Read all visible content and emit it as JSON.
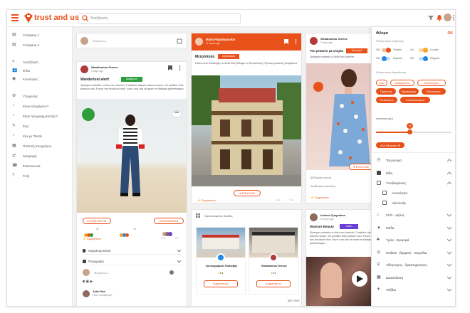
{
  "app": {
    "brand": "trust and use"
  },
  "search": {
    "placeholder": "Αναζήτηση"
  },
  "sidebar": {
    "items": [
      {
        "label": "Company 1",
        "icon": "company-icon"
      },
      {
        "label": "Company 2",
        "icon": "company-icon"
      },
      {
        "label": "Αναζήτηση",
        "icon": "pin-icon"
      },
      {
        "label": "Φίλοι",
        "icon": "friends-icon"
      },
      {
        "label": "Κοινότητες",
        "icon": "community-icon"
      },
      {
        "label": "Υπηρεσίες",
        "icon": "settings-icon"
      },
      {
        "label": "Είναι ελεγχόμενο?",
        "icon": "person-icon"
      },
      {
        "label": "Είναι προγραμματιστής?",
        "icon": "person-icon"
      },
      {
        "label": "Εύρ",
        "icon": "edit-icon"
      },
      {
        "label": "Καν με Tendo",
        "icon": "person-icon"
      },
      {
        "label": "Πολιτική απορρήτου",
        "icon": "policy-icon"
      },
      {
        "label": "Διαγραφή",
        "icon": "delete-icon"
      },
      {
        "label": "Επικοινωνία",
        "icon": "contact-icon"
      },
      {
        "label": "FAQ",
        "icon": "help-icon"
      }
    ]
  },
  "col1": {
    "compose_placeholder": "Μοιράσου...",
    "post": {
      "author": "Stradivarius Greece",
      "time": "5 days ago",
      "title": "Wanderlust alert!",
      "badge": "Διαφήμιση",
      "body": "Quisque molestie a dolor nec laoreet. Curabitur aliquet mauris neque, vel porttitor felis pretium sed. Fusce nec tincidunt nibh. Nunc non-nisi sit amet mi tristique pellentesque.",
      "like_label": "ΕΠΙΚΥΝΩ",
      "like_count": "95",
      "contact_label": "ΕΠΙΚΟΙΝΩΝΙΑ",
      "reactions_count": "32",
      "reactions_count2": "14",
      "comments_link": "Εμφανίσεις",
      "comment_count": "3",
      "share_count": "5",
      "dropdowns": [
        "Χαρακτηριστικά",
        "Περιγραφή"
      ],
      "comment_placeholder": "Μοιράσου...",
      "commenter_name": "John Doe",
      "commenter_text": "Πολύ ενδιαφέρον!"
    }
  },
  "col2": {
    "post": {
      "author": "Maria Papadopoulou",
      "time": "11 hours ago",
      "title": "Μετρόπολη",
      "badge": "Σχεδιασμός",
      "body": "Πόσο είναι Κασσιοβή το αλλά 8ev βάλαμε το Μετρόπολη ?Χρυσό γεώλιτα ξυλοβολευτ",
      "like_label": "ΕΠΙΚΥΝΩ",
      "comments_link": "Εμφανίσεις",
      "comment_count": "1",
      "share_count": "3"
    },
    "recommended": {
      "title": "Προτεινόμενες σελίδες",
      "pages": [
        {
          "name": "Σουπερμάρκετ Παλαιβάς",
          "button": "Εμφανίσεων"
        },
        {
          "name": "Stradivarius Greece",
          "button": "Εμφανίσεων"
        }
      ],
      "see_all": "ΔΕΣ ΟΛΕΣ"
    }
  },
  "col3": {
    "post": {
      "author": "Stradivarius Greece",
      "time": "3 days ago",
      "title": "Του μπαστο με στερία",
      "badge": "Προφορά",
      "body": "Quisque molestie a dolor nec laoreet.",
      "like_label": "ΕΠΙΚΥΝΩ",
      "info_rows": [
        "Εύρεση εικόνα",
        "Διαθέσιμα εκπτώσεις"
      ],
      "comments_link": "Εμφανίσεις"
    },
    "post2": {
      "author": "Ιωάννα Σμυρνάιου",
      "time": "8 hours ago",
      "title": "Walmart Beauty",
      "badge": "Video",
      "body": "Quisque molestie a dolor nec laoreet. Curabitur aliquet mauris neque, vel porttitor felis pretium sed. Fusce nec tincidunt nibh. Nunc non nisi sit amet mi tristique pellentesque."
    }
  },
  "filter": {
    "title": "Φίλτρα",
    "ok": "OK",
    "section1": "Φίλτρα τύπου ανάρτησης",
    "toggles": [
      {
        "off": "Off",
        "label": "Trusted",
        "state": "On",
        "label2": "Οι φίλοι"
      },
      {
        "off": "Off",
        "label": "Παρουσ.",
        "state": "Off",
        "label2": "Πληρώσ"
      }
    ],
    "section2": "Φίλτρα τύπου δημοσίευσης",
    "chips": [
      "Όλα",
      "Διαφημίσεις",
      "Αλληλεγγύη",
      "Προϊόντα",
      "Προσφορές",
      "Εκπτώσεις",
      "Κατάλογος",
      "Αποθηκευμένα"
    ],
    "distance_label": "Απόσταση (χιλ)",
    "distance_value": "45",
    "distance_fraction": 0.45,
    "active_chip": "Αλα Κέρκυρα",
    "categories": [
      {
        "label": "Τεχνολογία",
        "icon": "tech-icon",
        "checkbox": false
      },
      {
        "label": "Είδη",
        "icon": "",
        "checkbox": true,
        "checked": true
      },
      {
        "label": "Υποδιαιρέσεις",
        "icon": "",
        "checkbox": true,
        "checked": false
      },
      {
        "label": "Αυτοκίνητα",
        "icon": "",
        "checkbox": true,
        "checked": false,
        "indent": true
      },
      {
        "label": "Αξεσουάρ",
        "icon": "",
        "checkbox": true,
        "checked": false,
        "indent": true
      },
      {
        "label": "Σπίτι - κήπος",
        "icon": "home-icon",
        "checkbox": false
      },
      {
        "label": "Μόδα",
        "icon": "fashion-icon",
        "checkbox": false
      },
      {
        "label": "Υγεία - Ομορφιά",
        "icon": "beauty-icon",
        "checkbox": false
      },
      {
        "label": "Παιδικά - βρεφικά - παιχνίδια",
        "icon": "kids-icon",
        "checkbox": false
      },
      {
        "label": "Αθλητισμός - δραστηριότητες",
        "icon": "sport-icon",
        "checkbox": false
      },
      {
        "label": "Διασκέδαση",
        "icon": "fun-icon",
        "checkbox": false
      },
      {
        "label": "Ταξίδια",
        "icon": "travel-icon",
        "checkbox": false
      }
    ]
  },
  "colors": {
    "accent": "#e8521a",
    "green": "#2e9d3c",
    "purple": "#6a3fd6",
    "blue": "#1e88e5"
  }
}
